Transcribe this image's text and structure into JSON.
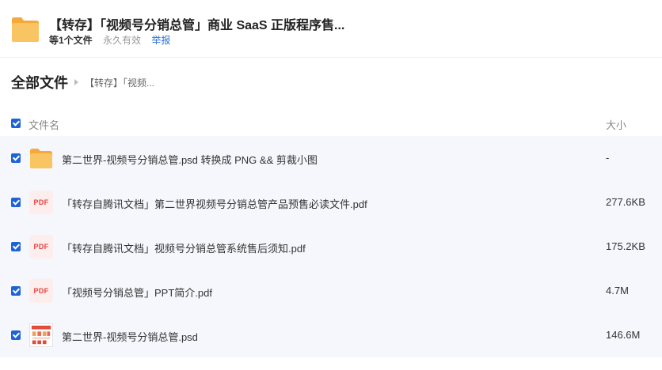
{
  "share": {
    "title": "【转存】「视频号分销总管」商业 SaaS 正版程序售...",
    "file_count": "等1个文件",
    "validity": "永久有效",
    "report": "举报"
  },
  "breadcrumb": {
    "root": "全部文件",
    "current": "【转存】「视频..."
  },
  "list_header": {
    "name_label": "文件名",
    "size_label": "大小"
  },
  "files": [
    {
      "name": "第二世界-视频号分销总管.psd 转换成 PNG && 剪裁小图",
      "size": "-",
      "icon": "folder-icon"
    },
    {
      "name": "「转存自腾讯文档」第二世界视频号分销总管产品预售必读文件.pdf",
      "size": "277.6KB",
      "icon": "pdf-icon",
      "badge": "PDF"
    },
    {
      "name": "「转存自腾讯文档」视频号分销总管系统售后须知.pdf",
      "size": "175.2KB",
      "icon": "pdf-icon",
      "badge": "PDF"
    },
    {
      "name": "「视频号分销总管」PPT简介.pdf",
      "size": "4.7M",
      "icon": "pdf-icon",
      "badge": "PDF"
    },
    {
      "name": "第二世界-视频号分销总管.psd",
      "size": "146.6M",
      "icon": "psd-thumbnail-icon"
    }
  ],
  "colors": {
    "accent": "#1e63d6",
    "link": "#2d6fd6",
    "folder": "#f7b84b",
    "pdf": "#e8423f",
    "row_bg": "#f6f7fc"
  }
}
